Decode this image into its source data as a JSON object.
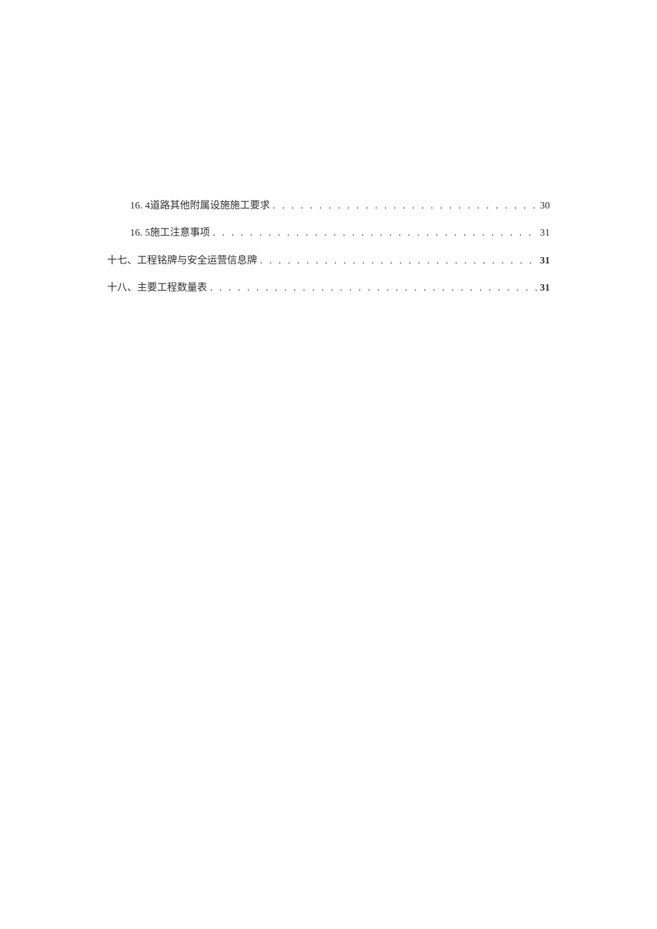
{
  "toc": {
    "entries": [
      {
        "label": "16. 4道路其他附属设施施工要求",
        "page": "30",
        "indented": true,
        "bold": false
      },
      {
        "label": "16. 5施工注意事项",
        "page": "31",
        "indented": true,
        "bold": false
      },
      {
        "label": "十七、工程铭牌与安全运营信息牌",
        "page": "31",
        "indented": false,
        "bold": true
      },
      {
        "label": "十八、主要工程数量表",
        "page": "31",
        "indented": false,
        "bold": true
      }
    ],
    "dots": ". . . . . . . . . . . . . . . . . . . . . . . . . . . . . . . . . . . . . . . . . . . . . . . . . . . . . . . . . . . . . . . . . . . . . . . . . . . . . . . . . . ."
  }
}
